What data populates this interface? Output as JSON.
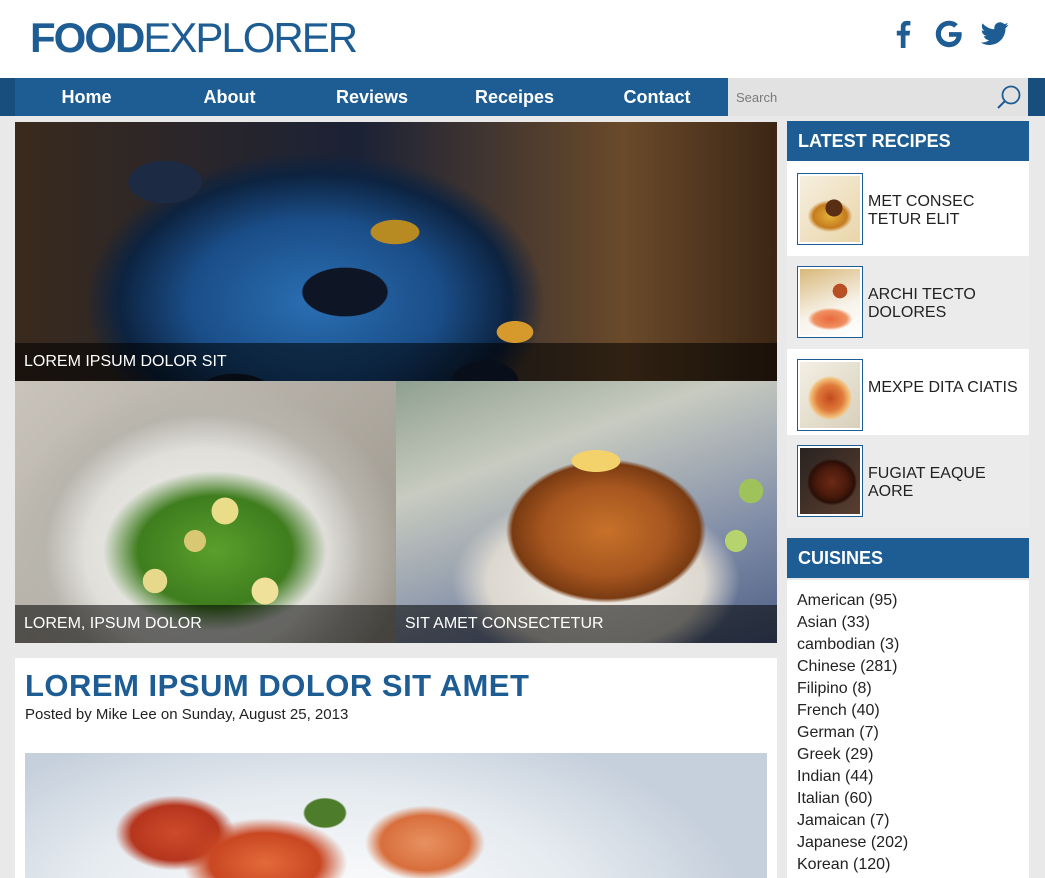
{
  "logo": {
    "bold": "FOOD",
    "light": "EXPLORER"
  },
  "social": [
    {
      "name": "facebook-icon"
    },
    {
      "name": "google-icon"
    },
    {
      "name": "twitter-icon"
    }
  ],
  "nav": {
    "items": [
      {
        "label": "Home"
      },
      {
        "label": "About"
      },
      {
        "label": "Reviews"
      },
      {
        "label": "Receipes"
      },
      {
        "label": "Contact"
      }
    ]
  },
  "search": {
    "placeholder": "Search"
  },
  "hero": {
    "main_caption": "LOREM IPSUM DOLOR SIT",
    "left_caption": "LOREM, IPSUM DOLOR",
    "right_caption": "SIT AMET CONSECTETUR"
  },
  "article": {
    "title": "LOREM IPSUM DOLOR SIT AMET",
    "meta": "Posted by Mike Lee on Sunday, August 25, 2013"
  },
  "sidebar": {
    "latest_title": "LATEST RECIPES",
    "recipes": [
      {
        "line1": "MET CONSEC",
        "line2": "TETUR ELIT"
      },
      {
        "line1": "ARCHI TECTO",
        "line2": "DOLORES"
      },
      {
        "line1": "MEXPE DITA CIATIS",
        "line2": ""
      },
      {
        "line1": "FUGIAT EAQUE",
        "line2": "AORE"
      }
    ],
    "cuisines_title": "CUISINES",
    "cuisines": [
      "American (95)",
      "Asian (33)",
      "cambodian (3)",
      "Chinese (281)",
      "Filipino (8)",
      "French (40)",
      "German (7)",
      "Greek (29)",
      "Indian (44)",
      "Italian (60)",
      "Jamaican (7)",
      "Japanese (202)",
      "Korean (120)"
    ]
  },
  "colors": {
    "brand": "#1d5d94",
    "nav_edge": "#174e7e",
    "page_bg": "#e9e9e9"
  }
}
